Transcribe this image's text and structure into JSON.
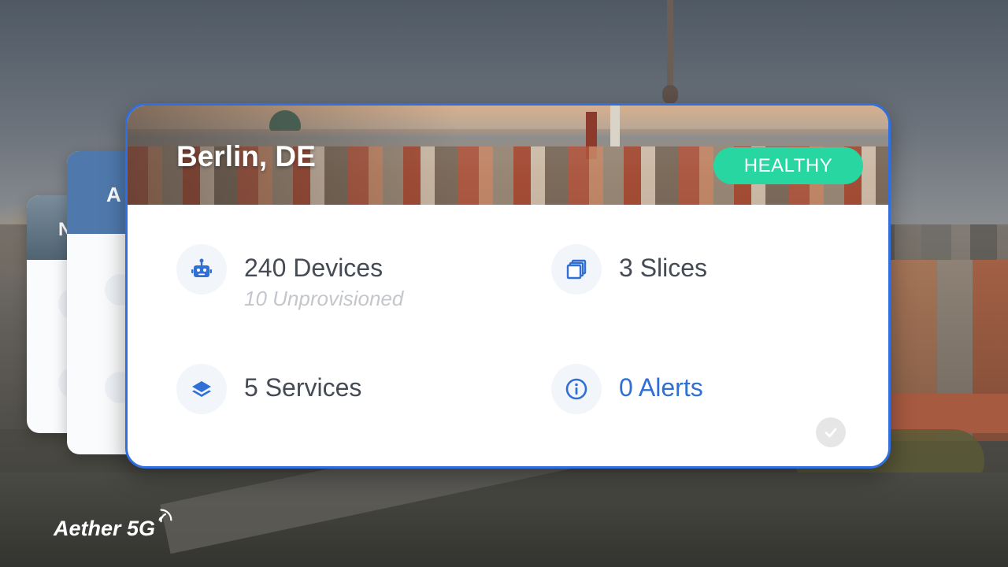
{
  "stack_cards": [
    {
      "title_fragment": "N"
    },
    {
      "title_fragment": "A"
    }
  ],
  "site_card": {
    "title": "Berlin, DE",
    "status": "HEALTHY",
    "metrics": {
      "devices": {
        "label": "240 Devices",
        "sub": "10 Unprovisioned",
        "icon": "robot-icon"
      },
      "slices": {
        "label": "3 Slices",
        "icon": "stacked-squares-icon"
      },
      "services": {
        "label": "5 Services",
        "icon": "layers-icon"
      },
      "alerts": {
        "label": "0 Alerts",
        "icon": "info-icon"
      }
    }
  },
  "brand": {
    "name": "Aether 5G"
  },
  "colors": {
    "accent": "#2f6fe0",
    "healthy": "#27d6a0",
    "icon_blue": "#2f6fd6",
    "text": "#454b55",
    "sub_text": "#c3c6cb"
  }
}
